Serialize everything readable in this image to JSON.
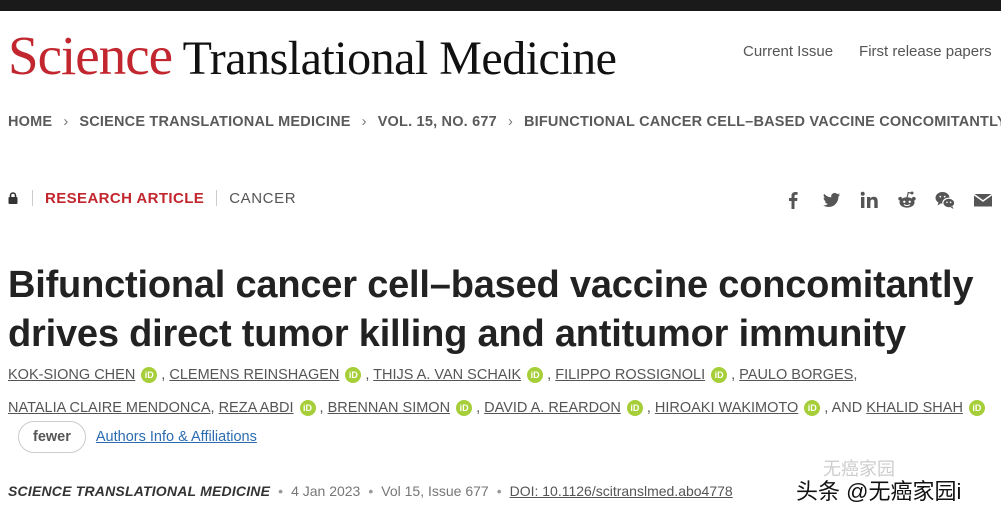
{
  "header": {
    "logo_science": "Science",
    "logo_rest": " Translational Medicine",
    "nav": [
      "Current Issue",
      "First release papers"
    ]
  },
  "breadcrumb": [
    "HOME",
    "SCIENCE TRANSLATIONAL MEDICINE",
    "VOL. 15, NO. 677",
    "BIFUNCTIONAL CANCER CELL–BASED VACCINE CONCOMITANTLY..."
  ],
  "article": {
    "type": "RESEARCH ARTICLE",
    "subject": "CANCER",
    "title": "Bifunctional cancer cell–based vaccine concomitantly drives direct tumor killing and antitumor immunity",
    "authors_line1": [
      "KOK-SIONG CHEN",
      "CLEMENS REINSHAGEN",
      "THIJS A. VAN SCHAIK",
      "FILIPPO ROSSIGNOLI",
      "PAULO BORGES"
    ],
    "authors_line2": [
      "NATALIA CLAIRE MENDONCA",
      "REZA ABDI",
      "BRENNAN SIMON",
      "DAVID A. REARDON",
      "HIROAKI WAKIMOTO"
    ],
    "and_label": "AND",
    "last_author": "KHALID SHAH",
    "orcid_label": "iD",
    "fewer_label": "fewer",
    "affiliations_link": "Authors Info & Affiliations"
  },
  "citation": {
    "journal": "SCIENCE TRANSLATIONAL MEDICINE",
    "date": "4 Jan 2023",
    "issue": "Vol 15, Issue 677",
    "doi": "DOI: 10.1126/scitranslmed.abo4778"
  },
  "share_icons": [
    "facebook-icon",
    "twitter-icon",
    "linkedin-icon",
    "reddit-icon",
    "wechat-icon",
    "email-icon"
  ],
  "watermark": {
    "faint": "无癌家园",
    "main": "头条 @无癌家园i"
  },
  "colors": {
    "brand_red": "#c2262e",
    "link_blue": "#2b6cb0",
    "orcid_green": "#a6ce39"
  }
}
